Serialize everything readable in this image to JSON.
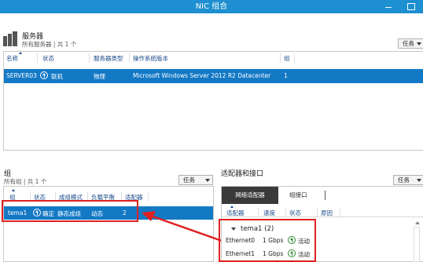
{
  "window": {
    "title": "NIC 组合"
  },
  "servers": {
    "title": "服务器",
    "subtitle": "所有服务器 | 共 1 个",
    "task_label": "任务",
    "columns": [
      "名称",
      "状态",
      "服务器类型",
      "操作系统版本",
      "组"
    ],
    "rows": [
      {
        "name": "SERVER03",
        "status": "联机",
        "type": "物理",
        "os": "Microsoft Windows Server 2012 R2 Datacenter",
        "group": "1"
      }
    ]
  },
  "groups": {
    "title": "组",
    "subtitle": "所有组 | 共 1 个",
    "task_label": "任务",
    "columns": [
      "组",
      "状态",
      "成组模式",
      "负载平衡",
      "适配器"
    ],
    "rows": [
      {
        "name": "tema1",
        "status": "确定",
        "mode": "静态成组",
        "balance": "动态",
        "adapters": "2"
      }
    ]
  },
  "adapters": {
    "title": "适配器和接口",
    "task_label": "任务",
    "tabs": [
      "网络适配器",
      "组接口"
    ],
    "columns": [
      "适配器",
      "速度",
      "状态",
      "原因"
    ],
    "team_label": "tema1 (2)",
    "rows": [
      {
        "name": "Ethernet0",
        "speed": "1 Gbps",
        "status": "活动"
      },
      {
        "name": "Ethernet1",
        "speed": "1 Gbps",
        "status": "活动"
      }
    ]
  },
  "colors": {
    "titlebar": "#1e8fd0",
    "selection": "#1479c5",
    "highlight_box": "#e02020"
  },
  "icons": [
    "server-icon",
    "status-online-icon",
    "sort-arrow-icon",
    "dropdown-caret-icon",
    "expand-triangle-icon"
  ]
}
